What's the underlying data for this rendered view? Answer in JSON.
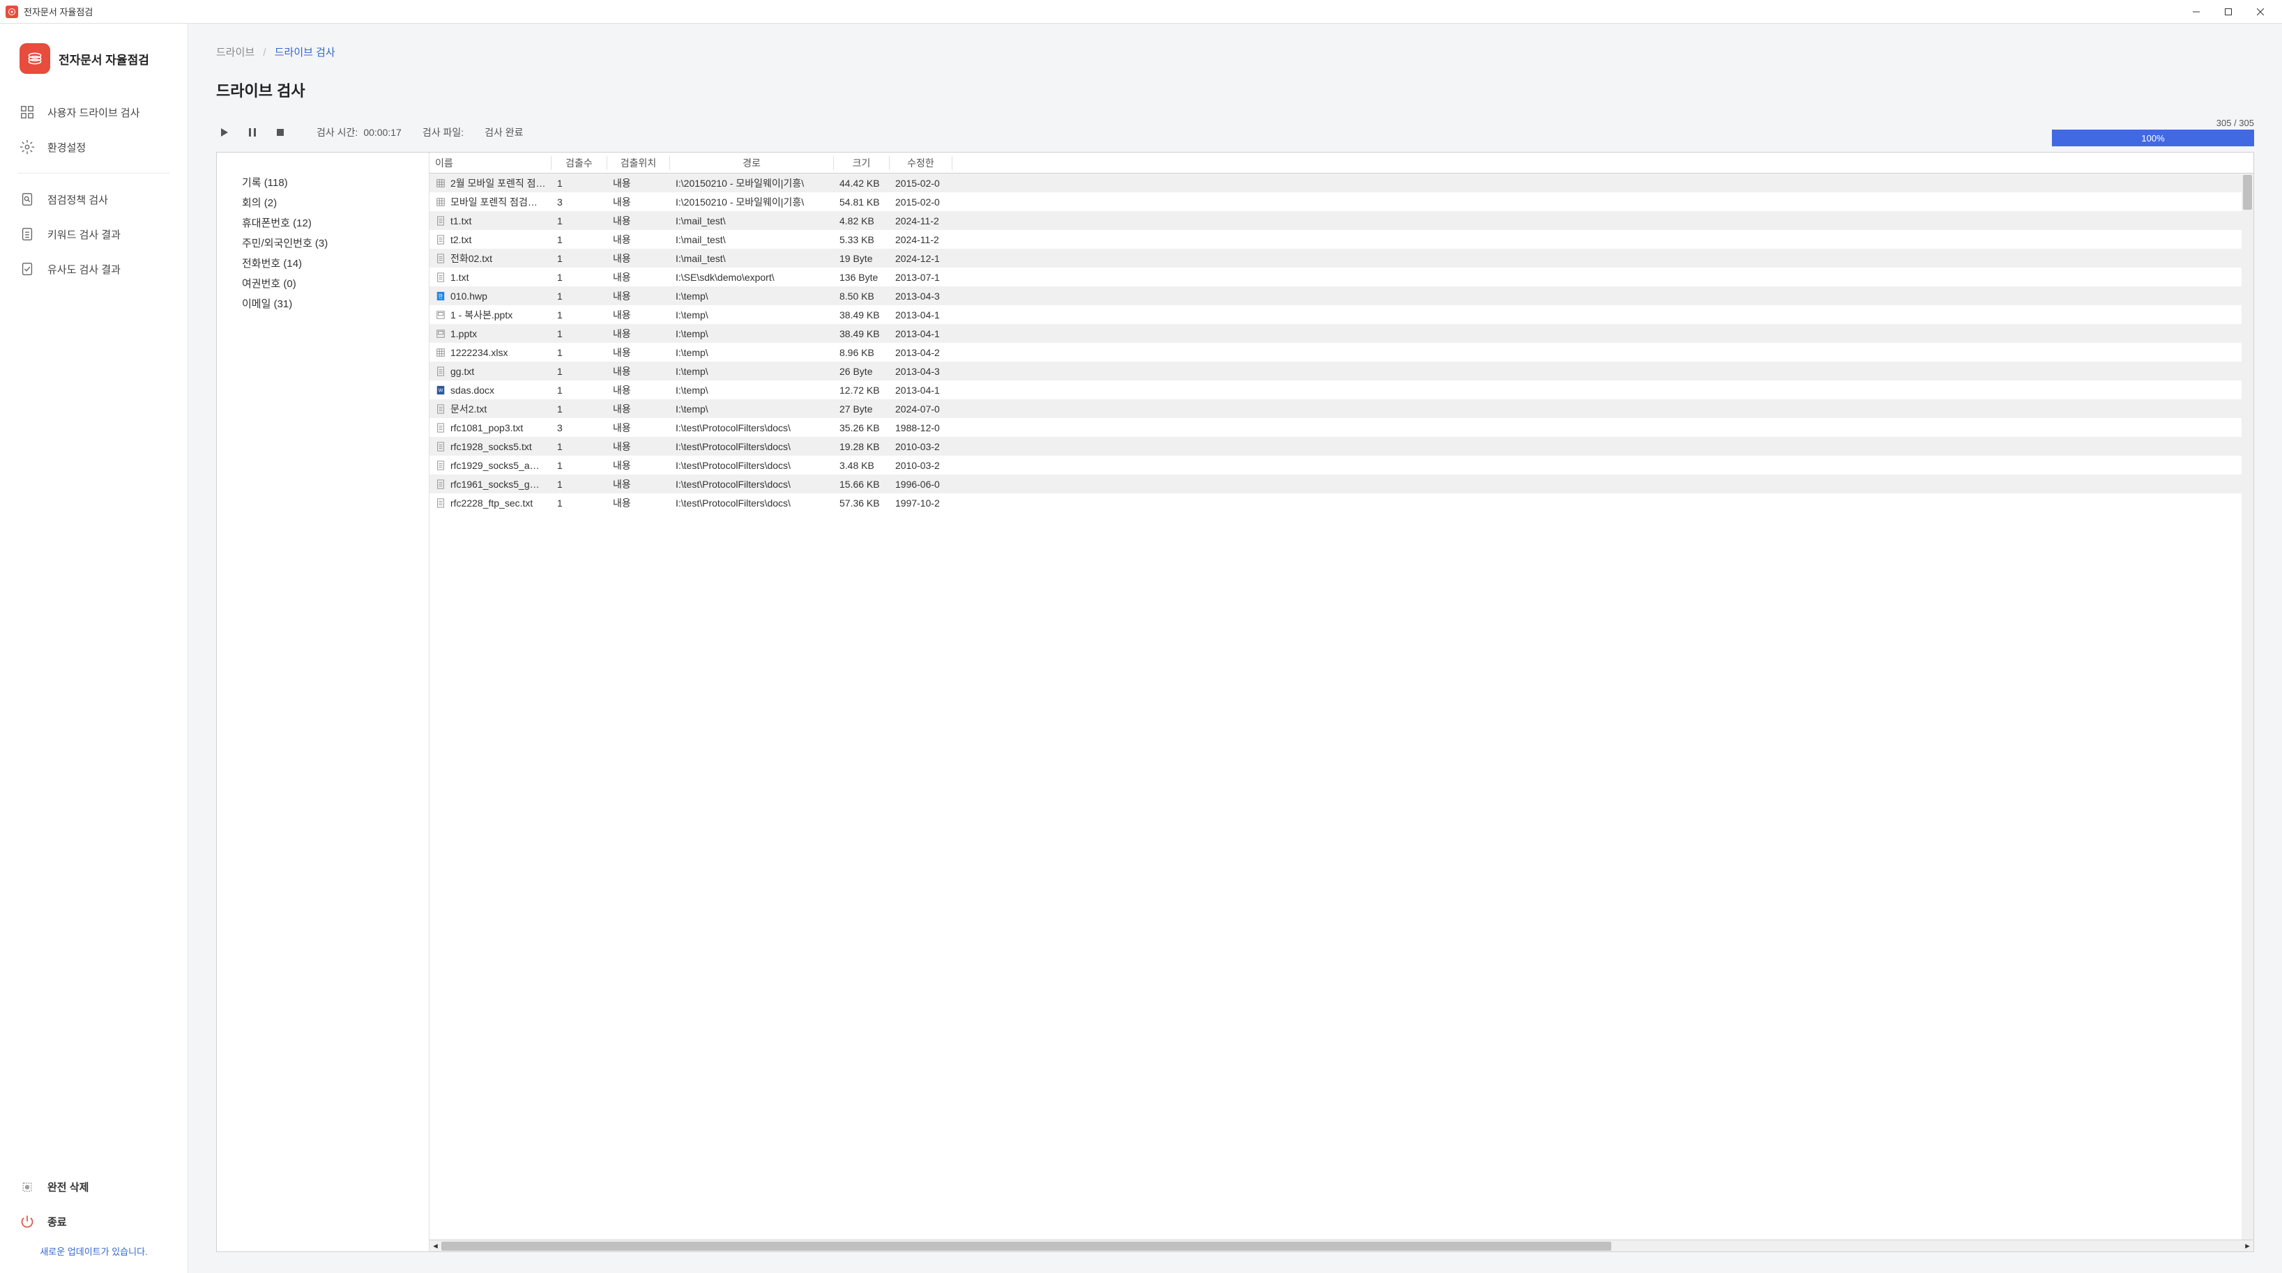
{
  "titlebar": {
    "title": "전자문서 자율점검"
  },
  "sidebar": {
    "app_title": "전자문서 자율점검",
    "items": [
      {
        "label": "사용자 드라이브 검사"
      },
      {
        "label": "환경설정"
      },
      {
        "label": "점검정책 검사"
      },
      {
        "label": "키워드 검사 결과"
      },
      {
        "label": "유사도 검사 결과"
      }
    ],
    "delete_all": "완전 삭제",
    "exit": "종료",
    "update_notice": "새로운 업데이트가 있습니다."
  },
  "breadcrumb": {
    "root": "드라이브",
    "current": "드라이브 검사"
  },
  "page_title": "드라이브 검사",
  "status": {
    "time_label": "검사 시간:",
    "time_value": "00:00:17",
    "file_label": "검사 파일:",
    "done_label": "검사 완료"
  },
  "progress": {
    "count": "305 / 305",
    "percent": "100%"
  },
  "categories": [
    {
      "label": "기록 (118)"
    },
    {
      "label": "회의 (2)"
    },
    {
      "label": "휴대폰번호 (12)"
    },
    {
      "label": "주민/외국인번호 (3)"
    },
    {
      "label": "전화번호 (14)"
    },
    {
      "label": "여권번호 (0)"
    },
    {
      "label": "이메일 (31)"
    }
  ],
  "columns": {
    "name": "이름",
    "count": "검출수",
    "location": "검출위치",
    "path": "경로",
    "size": "크기",
    "modified": "수정한"
  },
  "rows": [
    {
      "icon": "sheet",
      "name": "2월 모바일 포렌직 점…",
      "count": "1",
      "loc": "내용",
      "path": "I:\\20150210 - 모바일웨이|기흥\\",
      "size": "44.42 KB",
      "date": "2015-02-0"
    },
    {
      "icon": "sheet",
      "name": "모바일 포렌직 점검…",
      "count": "3",
      "loc": "내용",
      "path": "I:\\20150210 - 모바일웨이|기흥\\",
      "size": "54.81 KB",
      "date": "2015-02-0"
    },
    {
      "icon": "txt",
      "name": "t1.txt",
      "count": "1",
      "loc": "내용",
      "path": "I:\\mail_test\\",
      "size": "4.82 KB",
      "date": "2024-11-2"
    },
    {
      "icon": "txt",
      "name": "t2.txt",
      "count": "1",
      "loc": "내용",
      "path": "I:\\mail_test\\",
      "size": "5.33 KB",
      "date": "2024-11-2"
    },
    {
      "icon": "txt",
      "name": "전화02.txt",
      "count": "1",
      "loc": "내용",
      "path": "I:\\mail_test\\",
      "size": "19 Byte",
      "date": "2024-12-1"
    },
    {
      "icon": "txt",
      "name": "1.txt",
      "count": "1",
      "loc": "내용",
      "path": "I:\\SE\\sdk\\demo\\export\\",
      "size": "136 Byte",
      "date": "2013-07-1"
    },
    {
      "icon": "hwp",
      "name": "010.hwp",
      "count": "1",
      "loc": "내용",
      "path": "I:\\temp\\",
      "size": "8.50 KB",
      "date": "2013-04-3"
    },
    {
      "icon": "pptx",
      "name": "1 - 복사본.pptx",
      "count": "1",
      "loc": "내용",
      "path": "I:\\temp\\",
      "size": "38.49 KB",
      "date": "2013-04-1"
    },
    {
      "icon": "pptx",
      "name": "1.pptx",
      "count": "1",
      "loc": "내용",
      "path": "I:\\temp\\",
      "size": "38.49 KB",
      "date": "2013-04-1"
    },
    {
      "icon": "sheet",
      "name": "1222234.xlsx",
      "count": "1",
      "loc": "내용",
      "path": "I:\\temp\\",
      "size": "8.96 KB",
      "date": "2013-04-2"
    },
    {
      "icon": "txt",
      "name": "gg.txt",
      "count": "1",
      "loc": "내용",
      "path": "I:\\temp\\",
      "size": "26 Byte",
      "date": "2013-04-3"
    },
    {
      "icon": "docx",
      "name": "sdas.docx",
      "count": "1",
      "loc": "내용",
      "path": "I:\\temp\\",
      "size": "12.72 KB",
      "date": "2013-04-1"
    },
    {
      "icon": "txt",
      "name": "문서2.txt",
      "count": "1",
      "loc": "내용",
      "path": "I:\\temp\\",
      "size": "27 Byte",
      "date": "2024-07-0"
    },
    {
      "icon": "txt",
      "name": "rfc1081_pop3.txt",
      "count": "3",
      "loc": "내용",
      "path": "I:\\test\\ProtocolFilters\\docs\\",
      "size": "35.26 KB",
      "date": "1988-12-0"
    },
    {
      "icon": "txt",
      "name": "rfc1928_socks5.txt",
      "count": "1",
      "loc": "내용",
      "path": "I:\\test\\ProtocolFilters\\docs\\",
      "size": "19.28 KB",
      "date": "2010-03-2"
    },
    {
      "icon": "txt",
      "name": "rfc1929_socks5_a…",
      "count": "1",
      "loc": "내용",
      "path": "I:\\test\\ProtocolFilters\\docs\\",
      "size": "3.48 KB",
      "date": "2010-03-2"
    },
    {
      "icon": "txt",
      "name": "rfc1961_socks5_g…",
      "count": "1",
      "loc": "내용",
      "path": "I:\\test\\ProtocolFilters\\docs\\",
      "size": "15.66 KB",
      "date": "1996-06-0"
    },
    {
      "icon": "txt",
      "name": "rfc2228_ftp_sec.txt",
      "count": "1",
      "loc": "내용",
      "path": "I:\\test\\ProtocolFilters\\docs\\",
      "size": "57.36 KB",
      "date": "1997-10-2"
    }
  ]
}
